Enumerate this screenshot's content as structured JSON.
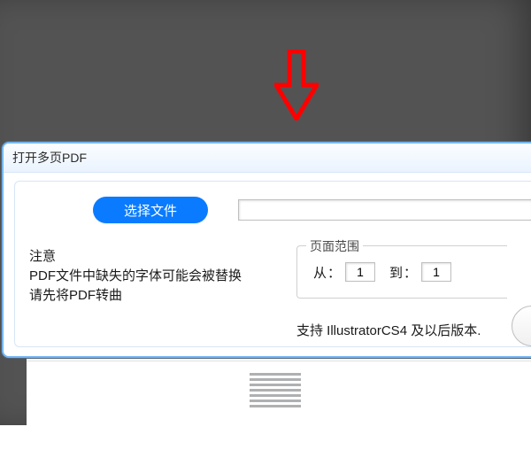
{
  "dialog": {
    "title": "打开多页PDF",
    "choose_button": "选择文件",
    "path_value": "",
    "note_heading": "注意",
    "note_line1": "PDF文件中缺失的字体可能会被替换",
    "note_line2": "请先将PDF转曲",
    "page_range_legend": "页面范围",
    "from_label": "从：",
    "to_label": "到：",
    "from_value": "1",
    "to_value": "1",
    "support_text": "支持 IllustratorCS4 及以后版本."
  }
}
